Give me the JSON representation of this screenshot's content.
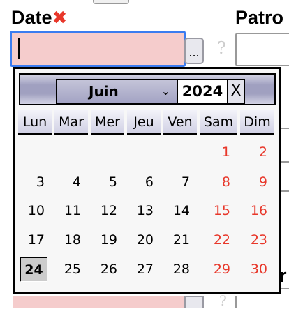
{
  "form": {
    "date_label": "Date",
    "required_mark": "✖",
    "date_value": "",
    "picker_button": "...",
    "help": "?",
    "patron_label": "Patro"
  },
  "calendar": {
    "month": "Juin",
    "year": "2024",
    "close": "X",
    "weekdays": [
      "Lun",
      "Mar",
      "Mer",
      "Jeu",
      "Ven",
      "Sam",
      "Dim"
    ],
    "days": [
      [
        "",
        "",
        "",
        "",
        "",
        "1",
        "2"
      ],
      [
        "3",
        "4",
        "5",
        "6",
        "7",
        "8",
        "9"
      ],
      [
        "10",
        "11",
        "12",
        "13",
        "14",
        "15",
        "16"
      ],
      [
        "17",
        "18",
        "19",
        "20",
        "21",
        "22",
        "23"
      ],
      [
        "24",
        "25",
        "26",
        "27",
        "28",
        "29",
        "30"
      ]
    ],
    "selected_day": "24",
    "weekend_color": "#e8372a"
  }
}
